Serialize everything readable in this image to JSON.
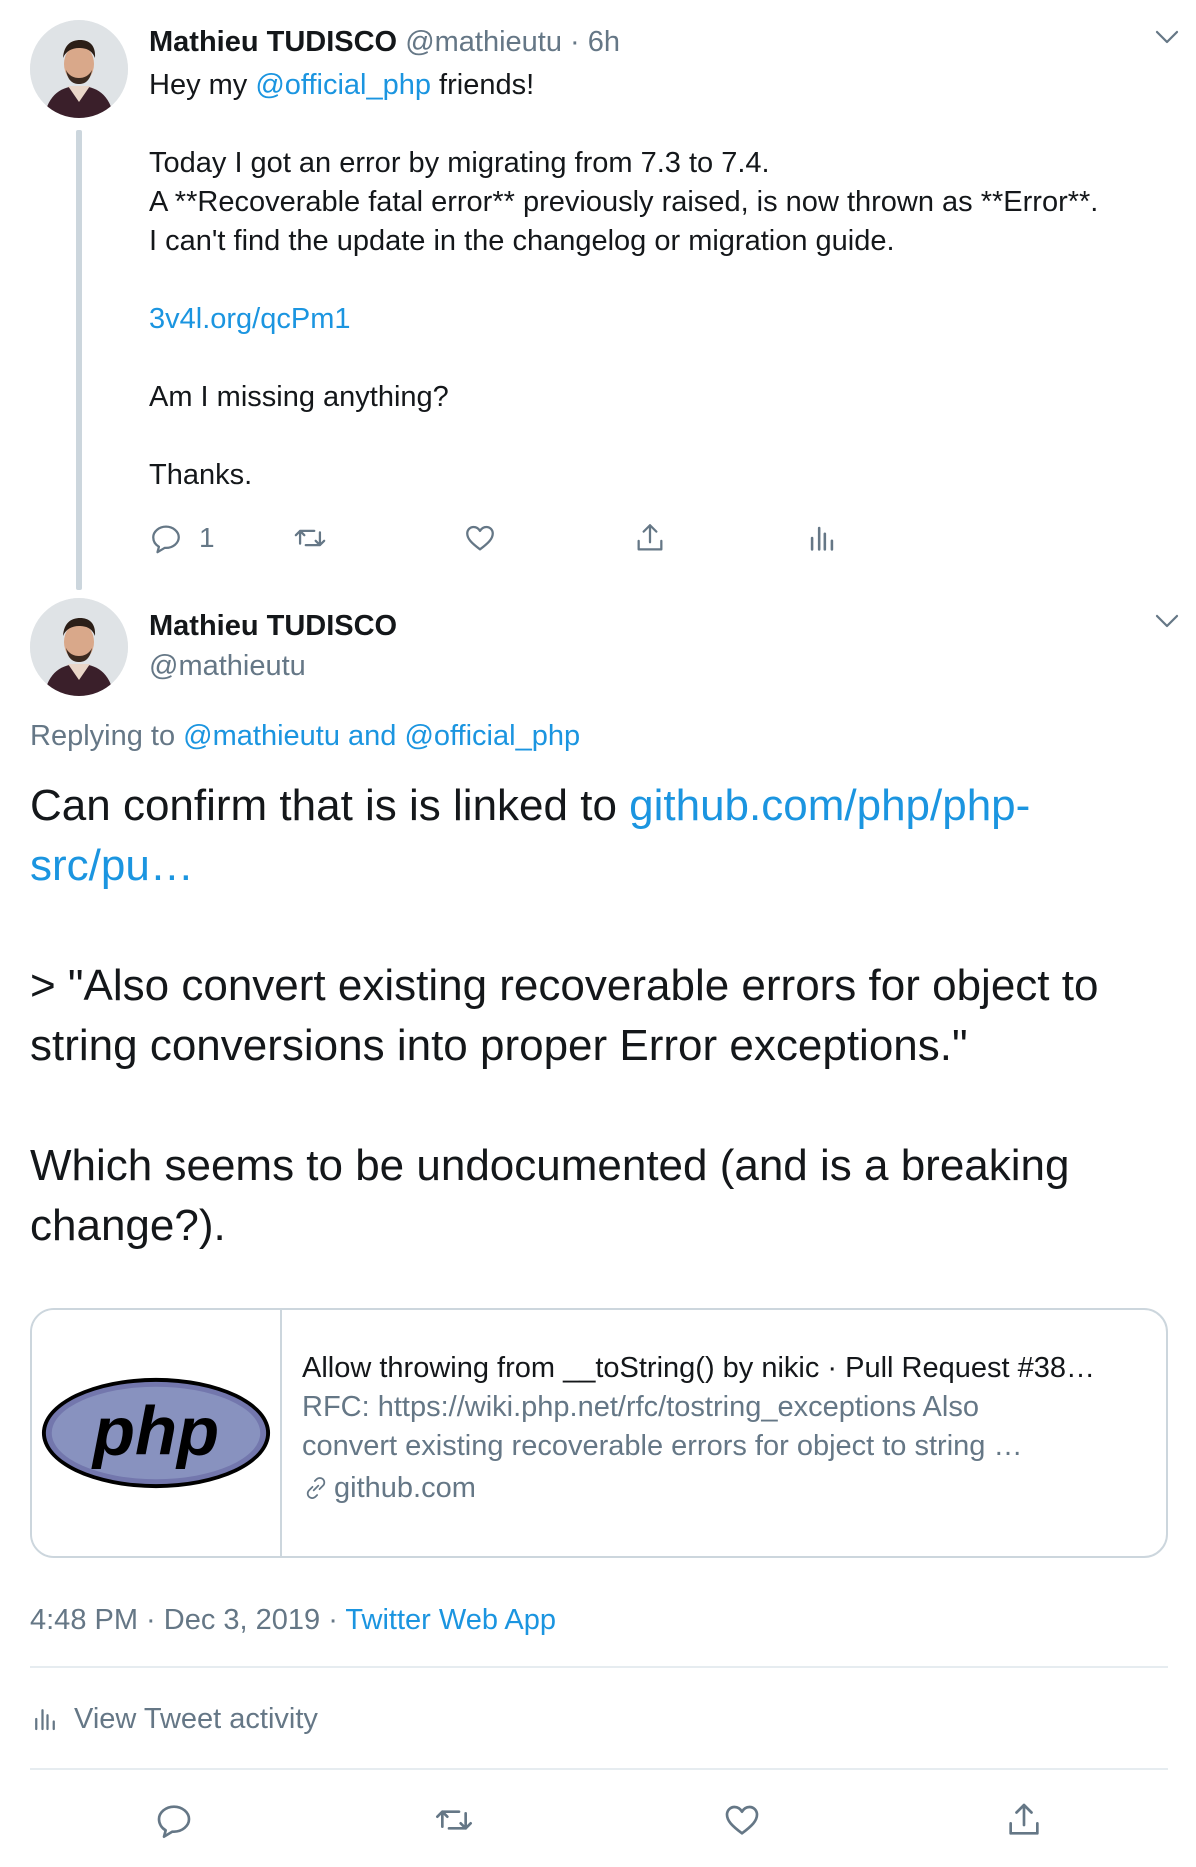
{
  "tweet1": {
    "name": "Mathieu TUDISCO",
    "handle": "@mathieutu",
    "dot": " · ",
    "time": "6h",
    "line1_pre": "Hey my ",
    "line1_mention": "@official_php",
    "line1_post": " friends!",
    "line2": "Today I got an error by migrating from 7.3 to 7.4.",
    "line3": "A **Recoverable fatal error** previously raised, is now thrown as **Error**.",
    "line4": "I can't find the update in the changelog or migration guide.",
    "link": "3v4l.org/qcPm1",
    "line5": "Am I missing anything?",
    "line6": "Thanks.",
    "reply_count": "1"
  },
  "tweet2": {
    "name": "Mathieu TUDISCO",
    "handle": "@mathieutu",
    "replying_prefix": "Replying to ",
    "replying_mentions": "@mathieutu and @official_php",
    "text_pre": "Can confirm that is is linked to ",
    "text_link_part1": "github.com/php/php-",
    "text_link_part2": "src/pu…",
    "quote_line1": "> \"Also convert existing recoverable errors for object to",
    "quote_line2": "string conversions into proper Error exceptions.\"",
    "final_line1": "Which seems to be undocumented (and is a breaking",
    "final_line2": "change?)."
  },
  "card": {
    "logo_text": "php",
    "title": "Allow throwing from __toString() by nikic · Pull Request #38…",
    "desc_line1": "RFC: https://wiki.php.net/rfc/tostring_exceptions Also",
    "desc_line2": "convert existing recoverable errors for object to string …",
    "domain": "github.com"
  },
  "meta": {
    "timestamp": "4:48 PM · Dec 3, 2019",
    "dot": " · ",
    "source": "Twitter Web App"
  },
  "activity": {
    "label": "View Tweet activity"
  },
  "colors": {
    "link": "#1b95e0",
    "muted": "#657786",
    "border": "#ccd6dd",
    "php_blue": "#7377ad"
  },
  "icons": [
    "chevron-down-icon",
    "reply-icon",
    "retweet-icon",
    "like-icon",
    "share-icon",
    "analytics-icon",
    "link-icon"
  ]
}
